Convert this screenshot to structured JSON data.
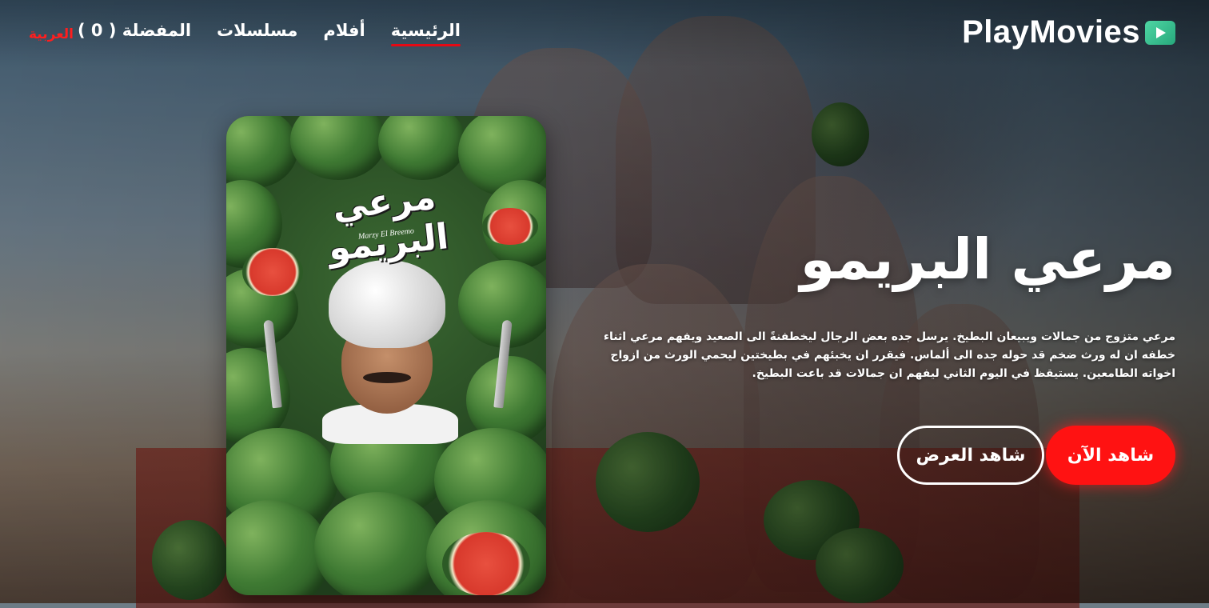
{
  "brand": {
    "name": "PlayMovies",
    "icon": "play-icon",
    "accent_color": "#3cc792"
  },
  "nav": {
    "items": [
      {
        "label": "الرئيسية",
        "active": true
      },
      {
        "label": "أفلام",
        "active": false
      },
      {
        "label": "مسلسلات",
        "active": false
      },
      {
        "label": "المفضلة ( 0 )",
        "active": false
      }
    ],
    "language_label": "العربية",
    "active_underline_color": "#e50914"
  },
  "featured": {
    "title": "مرعي البريمو",
    "description": "مرعي متزوج من جمالات ويبيعان البطيخ. يرسل جده بعض الرجال ليخطفنةً الى الصعيد ويفهم مرعي اثناء خطفه ان له ورث ضخم قد حوله جده الى ألماس. فيقرر ان يخبئهم في بطيختين ليحمي الورث من ازواج اخواته الطامعين. يستيقظ في اليوم الثاني ليفهم ان جمالات قد باعت البطيخ.",
    "poster": {
      "title_art": "مرعي البريمو",
      "subtitle_art": "Marzy El Breemo"
    },
    "buttons": {
      "watch_now": "شاهد الآن",
      "watch_trailer": "شاهد العرض"
    },
    "watch_button_color": "#ff1212"
  }
}
